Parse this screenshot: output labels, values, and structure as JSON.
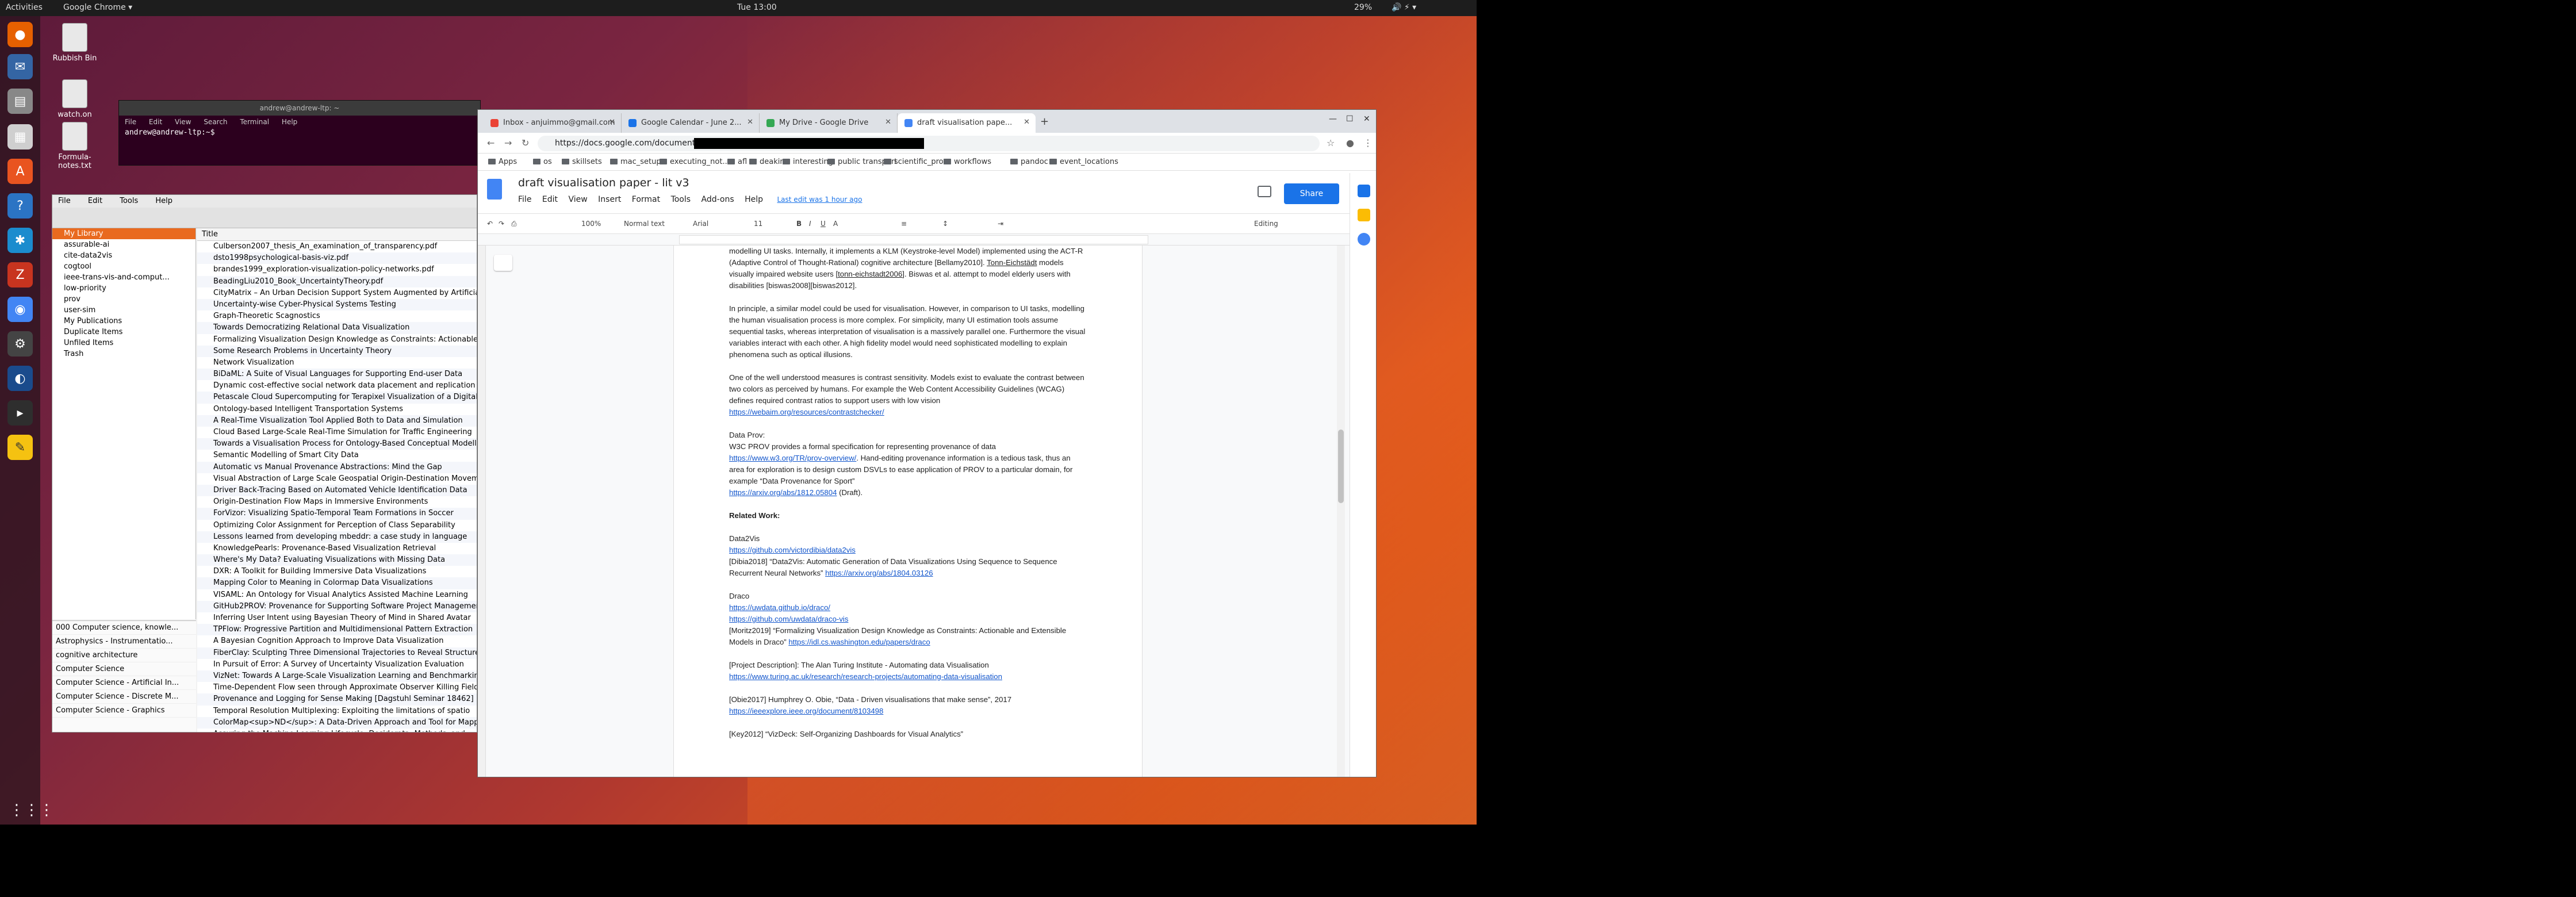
{
  "topbar": {
    "activities": "Activities",
    "app_menu": "Google Chrome ▾",
    "clock": "Tue 13:00",
    "battery": "29%"
  },
  "desktop_icons": [
    {
      "label": "Rubbish Bin"
    },
    {
      "label": "watch.on"
    },
    {
      "label": "Formula-notes.txt"
    }
  ],
  "terminal": {
    "title": "andrew@andrew-ltp: ~",
    "menu": [
      "File",
      "Edit",
      "View",
      "Search",
      "Terminal",
      "Help"
    ],
    "prompt": "andrew@andrew-ltp:~$ "
  },
  "zotero": {
    "menu": [
      "File",
      "Edit",
      "Tools",
      "Help"
    ],
    "collections": [
      "My Library",
      "assurable-ai",
      "cite-data2vis",
      "cogtool",
      "ieee-trans-vis-and-comput...",
      "low-priority",
      "prov",
      "user-sim",
      "My Publications",
      "Duplicate Items",
      "Unfiled Items",
      "Trash"
    ],
    "tags": [
      "000 Computer science, knowle...",
      "Astrophysics - Instrumentatio...",
      "cognitive architecture",
      "Computer Science",
      "Computer Science - Artificial In...",
      "Computer Science - Discrete M...",
      "Computer Science - Graphics"
    ],
    "column_title": "Title",
    "items": [
      "Culberson2007_thesis_An_examination_of_transparency.pdf",
      "dsto1998psychological-basis-viz.pdf",
      "brandes1999_exploration-visualization-policy-networks.pdf",
      "BeadingLiu2010_Book_UncertaintyTheory.pdf",
      "CityMatrix – An Urban Decision Support System Augmented by Artificial",
      "Uncertainty-wise Cyber-Physical Systems Testing",
      "Graph-Theoretic Scagnostics",
      "Towards Democratizing Relational Data Visualization",
      "Formalizing Visualization Design Knowledge as Constraints: Actionable",
      "Some Research Problems in Uncertainty Theory",
      "Network Visualization",
      "BiDaML: A Suite of Visual Languages for Supporting End-user Data",
      "Dynamic cost-effective social network data placement and replication",
      "Petascale Cloud Supercomputing for Terapixel Visualization of a Digital",
      "Ontology-based Intelligent Transportation Systems",
      "A Real-Time Visualization Tool Applied Both to Data and Simulation",
      "Cloud Based Large-Scale Real-Time Simulation for Traffic Engineering",
      "Towards a Visualisation Process for Ontology-Based Conceptual Modelling",
      "Semantic Modelling of Smart City Data",
      "Automatic vs Manual Provenance Abstractions: Mind the Gap",
      "Visual Abstraction of Large Scale Geospatial Origin-Destination Movement",
      "Driver Back-Tracing Based on Automated Vehicle Identification Data",
      "Origin-Destination Flow Maps in Immersive Environments",
      "ForVizor: Visualizing Spatio-Temporal Team Formations in Soccer",
      "Optimizing Color Assignment for Perception of Class Separability",
      "Lessons learned from developing mbeddr: a case study in language",
      "KnowledgePearls: Provenance-Based Visualization Retrieval",
      "Where's My Data? Evaluating Visualizations with Missing Data",
      "DXR: A Toolkit for Building Immersive Data Visualizations",
      "Mapping Color to Meaning in Colormap Data Visualizations",
      "VISAML: An Ontology for Visual Analytics Assisted Machine Learning",
      "GitHub2PROV: Provenance for Supporting Software Project Management",
      "Inferring User Intent using Bayesian Theory of Mind in Shared Avatar",
      "TPFlow: Progressive Partition and Multidimensional Pattern Extraction",
      "A Bayesian Cognition Approach to Improve Data Visualization",
      "FiberClay: Sculpting Three Dimensional Trajectories to Reveal Structures",
      "In Pursuit of Error: A Survey of Uncertainty Visualization Evaluation",
      "VizNet: Towards A Large-Scale Visualization Learning and Benchmarking",
      "Time-Dependent Flow seen through Approximate Observer Killing Fields",
      "Provenance and Logging for Sense Making [Dagstuhl Seminar 18462]",
      "Temporal Resolution Multiplexing: Exploiting the limitations of spatio",
      "ColorMap<sup>ND</sup>: A Data-Driven Approach and Tool for Mapping",
      "Assuring the Machine Learning Lifecycle: Desiderata, Methods, and"
    ]
  },
  "chrome": {
    "tabs": [
      {
        "label": "Inbox - anjuimmo@gmail.com",
        "color": "#ea4335"
      },
      {
        "label": "Google Calendar - June 2...",
        "color": "#1a73e8"
      },
      {
        "label": "My Drive - Google Drive",
        "color": "#34a853"
      },
      {
        "label": "draft visualisation pape...",
        "color": "#4285f4"
      }
    ],
    "url": "https://docs.google.com/document/d/",
    "bookmarks": [
      "Apps",
      "os",
      "skillsets",
      "mac_setup",
      "executing_not...",
      "afl",
      "deakin",
      "interesting",
      "public transport",
      "scientific_pro...",
      "workflows",
      "pandoc",
      "event_locations"
    ]
  },
  "docs": {
    "title": "draft visualisation paper - lit v3",
    "menu": [
      "File",
      "Edit",
      "View",
      "Insert",
      "Format",
      "Tools",
      "Add-ons",
      "Help"
    ],
    "last_edit": "Last edit was 1 hour ago",
    "share": "Share",
    "toolbar": {
      "zoom": "100%",
      "style": "Normal text",
      "font": "Arial",
      "size": "11",
      "mode": "Editing"
    }
  },
  "document": {
    "para1_a": "modelling UI tasks. Internally, it implements a KLM (Keystroke-level Model) implemented using the ACT-R (Adaptive Control of Thought-Rational) cognitive architecture [Bellamy2010]. ",
    "para1_u1": "Tonn-Eichstädt",
    "para1_b": " models visually impaired website users ",
    "para1_u2": "[tonn-eichstadt2006]",
    "para1_c": ". Biswas et al. attempt to model elderly users with disabilities [biswas2008][biswas2012].",
    "para2": "In principle, a similar model could be used for visualisation. However, in comparison to UI tasks, modelling the human visualisation process is more complex. For simplicity, many UI estimation tools assume sequential tasks, whereas interpretation of visualisation is a massively parallel one. Furthermore the visual variables interact with each other. A high fidelity model would need sophisticated modelling to explain phenomena such as optical illusions.",
    "para3_a": "One of the well understood measures is contrast sensitivity. Models exist to evaluate the contrast between two colors as perceived by humans. For example the Web Content Accessibility Guidelines (WCAG) defines required contrast ratios to support users with low vision ",
    "para3_link": "https://webaim.org/resources/contrastchecker/",
    "prov_head": "Data Prov:",
    "prov_a": "W3C PROV provides a formal specification for representing provenance of data ",
    "prov_link1": "https://www.w3.org/TR/prov-overview/",
    "prov_b": ". Hand-editing provenance information is a tedious task, thus an area for exploration is to design custom DSVLs to ease application of PROV to a particular domain, for example “Data Provenance for Sport”",
    "prov_link2": "https://arxiv.org/abs/1812.05804",
    "prov_c": " (Draft).",
    "related": "Related Work:",
    "d2v_head": "Data2Vis",
    "d2v_link": "https://github.com/victordibia/data2vis",
    "d2v_cite": "[Dibia2018] “Data2Vis: Automatic Generation of Data Visualizations Using Sequence to Sequence Recurrent Neural Networks” ",
    "d2v_cite_link": "https://arxiv.org/abs/1804.03126",
    "draco_head": "Draco",
    "draco_link1": "https://uwdata.github.io/draco/",
    "draco_link2": "https://github.com/uwdata/draco-vis",
    "moritz": "[Moritz2019] “Formalizing Visualization Design Knowledge as Constraints: Actionable and Extensible Models in Draco” ",
    "moritz_link": "https://idl.cs.washington.edu/papers/draco",
    "turing": "[Project Description]: The Alan Turing Institute - Automating data Visualisation",
    "turing_link": "https://www.turing.ac.uk/research/research-projects/automating-data-visualisation",
    "obie": "[Obie2017] Humphrey O. Obie, “Data - Driven visualisations that make sense”, 2017",
    "obie_link": "https://ieeexplore.ieee.org/document/8103498",
    "key": "[Key2012] “VizDeck: Self-Organizing Dashboards for Visual Analytics”"
  }
}
